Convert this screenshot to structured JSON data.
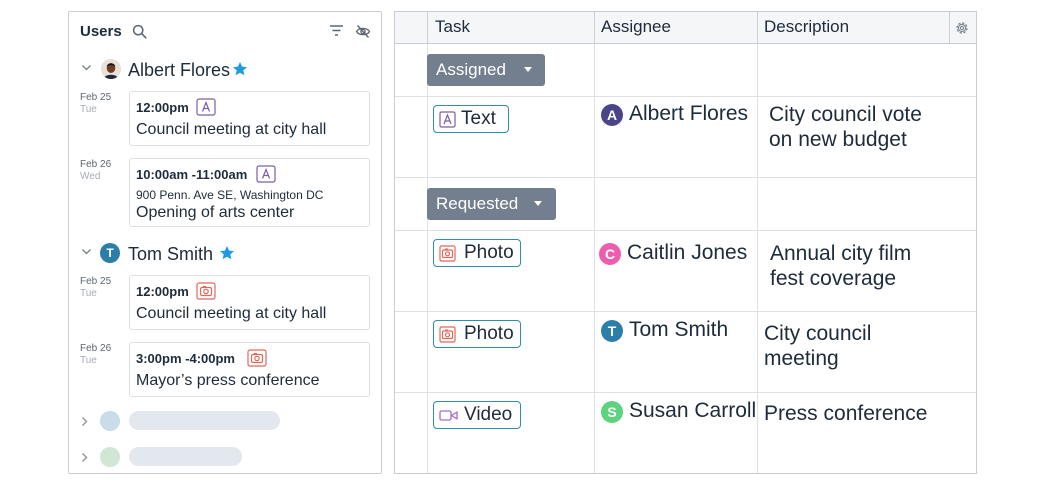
{
  "users_panel": {
    "title": "Users",
    "icons": {
      "search": "search-icon",
      "filter": "filter-icon",
      "hide": "eye-off-icon"
    },
    "users": [
      {
        "name": "Albert Flores",
        "starred": true,
        "events": [
          {
            "date": "Feb 25",
            "weekday": "Tue",
            "time": "12:00pm",
            "type": "text",
            "address": "",
            "title": "Council meeting at city hall"
          },
          {
            "date": "Feb 26",
            "weekday": "Wed",
            "time": "10:00am -11:00am",
            "type": "text",
            "address": "900 Penn. Ave SE, Washington DC",
            "title": "Opening of arts center"
          }
        ]
      },
      {
        "name": "Tom Smith",
        "initial": "T",
        "starred": true,
        "events": [
          {
            "date": "Feb 25",
            "weekday": "Tue",
            "time": "12:00pm",
            "type": "photo",
            "address": "",
            "title": "Council meeting at city hall"
          },
          {
            "date": "Feb 26",
            "weekday": "Tue",
            "time": "3:00pm -4:00pm",
            "type": "photo",
            "address": "",
            "title": "Mayor’s press conference"
          }
        ]
      }
    ]
  },
  "task_table": {
    "columns": [
      "Task",
      "Assignee",
      "Description"
    ],
    "settings_icon": "gear-icon",
    "groups": [
      {
        "label": "Assigned",
        "rows": [
          {
            "task": "Text",
            "task_icon": "text-icon",
            "assignee": "Albert Flores",
            "initial": "A",
            "color": "#4a4587",
            "description_lines": [
              "City council vote",
              "on new budget"
            ]
          }
        ]
      },
      {
        "label": "Requested",
        "rows": [
          {
            "task": "Photo",
            "task_icon": "camera-icon",
            "assignee": "Caitlin Jones",
            "initial": "C",
            "color": "#ee5cae",
            "description_lines": [
              "Annual city film",
              "fest coverage"
            ]
          },
          {
            "task": "Photo",
            "task_icon": "camera-icon",
            "assignee": "Tom Smith",
            "initial": "T",
            "color": "#2b7ea8",
            "description_lines": [
              "City council",
              "meeting"
            ]
          },
          {
            "task": "Video",
            "task_icon": "video-icon",
            "assignee": "Susan Carroll",
            "initial": "S",
            "color": "#5ed37d",
            "description_lines": [
              "Press conference"
            ]
          }
        ]
      }
    ]
  },
  "colors": {
    "accent_teal": "#2f8ea8",
    "text_icon": "#7b5ea7",
    "photo_icon": "#e0685a",
    "video_icon": "#a66cc7",
    "star": "#1e9be0",
    "group_button": "#737e8e"
  }
}
